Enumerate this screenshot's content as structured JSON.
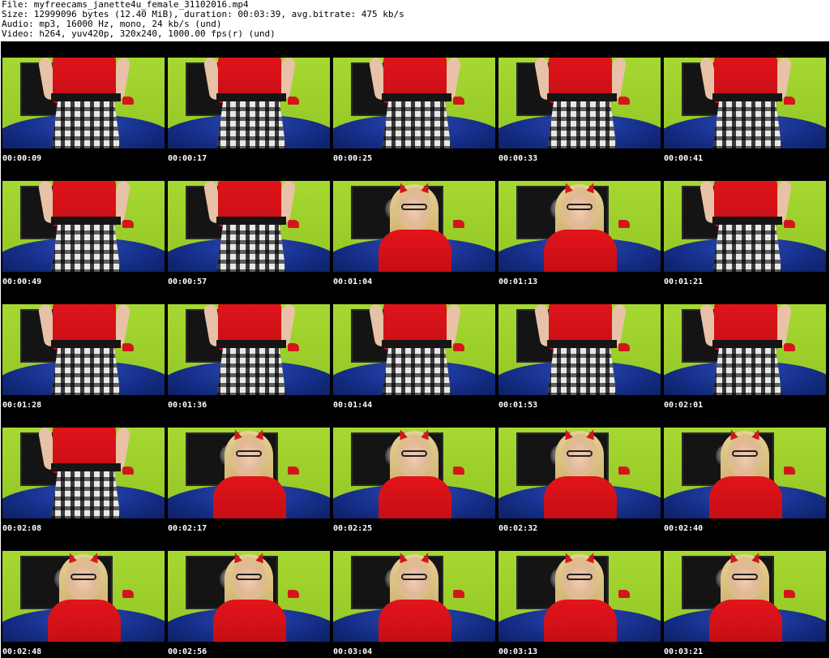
{
  "header": {
    "line1": "File: myfreecams_janette4u_female_31102016.mp4",
    "line2": "Size: 12999096 bytes (12.40 MiB), duration: 00:03:39, avg.bitrate: 475 kb/s",
    "line3": "Audio: mp3, 16000 Hz, mono, 24 kb/s (und)",
    "line4": "Video: h264, yuv420p, 320x240, 1000.00 fps(r) (und)"
  },
  "thumbnails": [
    {
      "time": "00:00:09",
      "scene": "skirt"
    },
    {
      "time": "00:00:17",
      "scene": "skirt"
    },
    {
      "time": "00:00:25",
      "scene": "skirt"
    },
    {
      "time": "00:00:33",
      "scene": "skirt"
    },
    {
      "time": "00:00:41",
      "scene": "skirt"
    },
    {
      "time": "00:00:49",
      "scene": "skirt"
    },
    {
      "time": "00:00:57",
      "scene": "skirt"
    },
    {
      "time": "00:01:04",
      "scene": "portrait"
    },
    {
      "time": "00:01:13",
      "scene": "portrait"
    },
    {
      "time": "00:01:21",
      "scene": "skirt"
    },
    {
      "time": "00:01:28",
      "scene": "skirt"
    },
    {
      "time": "00:01:36",
      "scene": "skirt"
    },
    {
      "time": "00:01:44",
      "scene": "skirt"
    },
    {
      "time": "00:01:53",
      "scene": "skirt"
    },
    {
      "time": "00:02:01",
      "scene": "skirt"
    },
    {
      "time": "00:02:08",
      "scene": "skirt"
    },
    {
      "time": "00:02:17",
      "scene": "portrait"
    },
    {
      "time": "00:02:25",
      "scene": "portrait"
    },
    {
      "time": "00:02:32",
      "scene": "portrait"
    },
    {
      "time": "00:02:40",
      "scene": "portrait"
    },
    {
      "time": "00:02:48",
      "scene": "portrait"
    },
    {
      "time": "00:02:56",
      "scene": "portrait"
    },
    {
      "time": "00:03:04",
      "scene": "portrait"
    },
    {
      "time": "00:03:13",
      "scene": "portrait"
    },
    {
      "time": "00:03:21",
      "scene": "portrait"
    }
  ],
  "colors": {
    "wall": "#9ccc2a",
    "sofa": "#142d85",
    "outfit": "#d4161c",
    "timestamp_text": "#ffffff",
    "grid_background": "#000000"
  }
}
